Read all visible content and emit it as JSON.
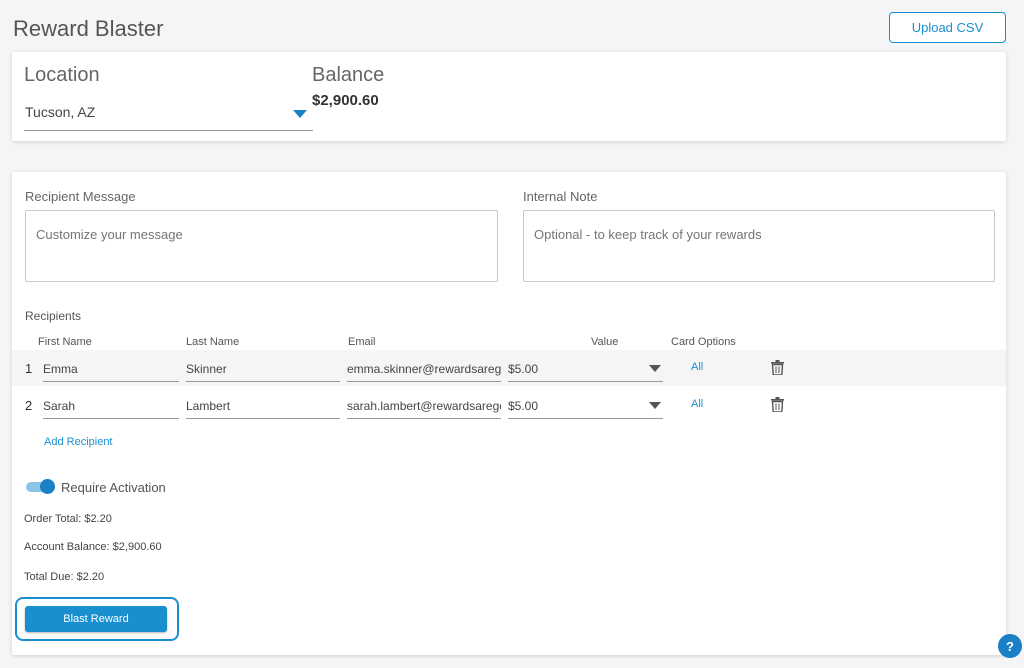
{
  "app": {
    "title": "Reward Blaster",
    "upload_label": "Upload CSV"
  },
  "location": {
    "label": "Location",
    "value": "Tucson, AZ"
  },
  "balance": {
    "label": "Balance",
    "value": "$2,900.60"
  },
  "message": {
    "label": "Recipient Message",
    "placeholder": "Customize your message"
  },
  "note": {
    "label": "Internal Note",
    "placeholder": "Optional - to keep track of your rewards"
  },
  "recipients": {
    "title": "Recipients",
    "columns": {
      "first": "First Name",
      "last": "Last Name",
      "email": "Email",
      "value": "Value",
      "options": "Card Options"
    },
    "rows": [
      {
        "num": "1",
        "first": "Emma",
        "last": "Skinner",
        "email": "emma.skinner@rewardsaregc",
        "value": "$5.00",
        "options": "All"
      },
      {
        "num": "2",
        "first": "Sarah",
        "last": "Lambert",
        "email": "sarah.lambert@rewardsaregc",
        "value": "$5.00",
        "options": "All"
      }
    ],
    "add_label": "Add Recipient"
  },
  "activation": {
    "label": "Require Activation",
    "enabled": true
  },
  "summary": {
    "order_total": "Order Total: $2.20",
    "account_balance": "Account Balance: $2,900.60",
    "total_due": "Total Due: $2.20"
  },
  "blast_label": "Blast Reward",
  "help_label": "?",
  "colors": {
    "accent": "#1a8fd0",
    "accent_dark": "#1a7fc4"
  }
}
